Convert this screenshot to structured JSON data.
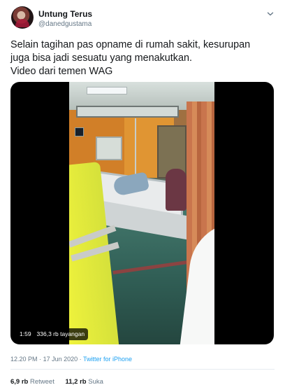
{
  "author": {
    "name": "Untung Terus",
    "handle": "@danedgustama"
  },
  "tweet": {
    "lines": [
      "Selain tagihan pas opname di rumah sakit, kesurupan",
      "juga bisa jadi sesuatu yang menakutkan.",
      "Video dari temen WAG"
    ]
  },
  "video": {
    "duration": "1:59",
    "views": "336,3 rb tayangan"
  },
  "meta": {
    "time": "12.20 PM",
    "date": "17 Jun 2020",
    "separator": "·",
    "source": "Twitter for iPhone"
  },
  "stats": {
    "retweet_count": "6,9 rb",
    "retweet_label": "Retweet",
    "like_count": "11,2 rb",
    "like_label": "Suka"
  },
  "icons": {
    "menu": "chevron-down-icon"
  },
  "colors": {
    "link": "#1da1f2",
    "muted": "#657786",
    "text": "#14171a"
  }
}
